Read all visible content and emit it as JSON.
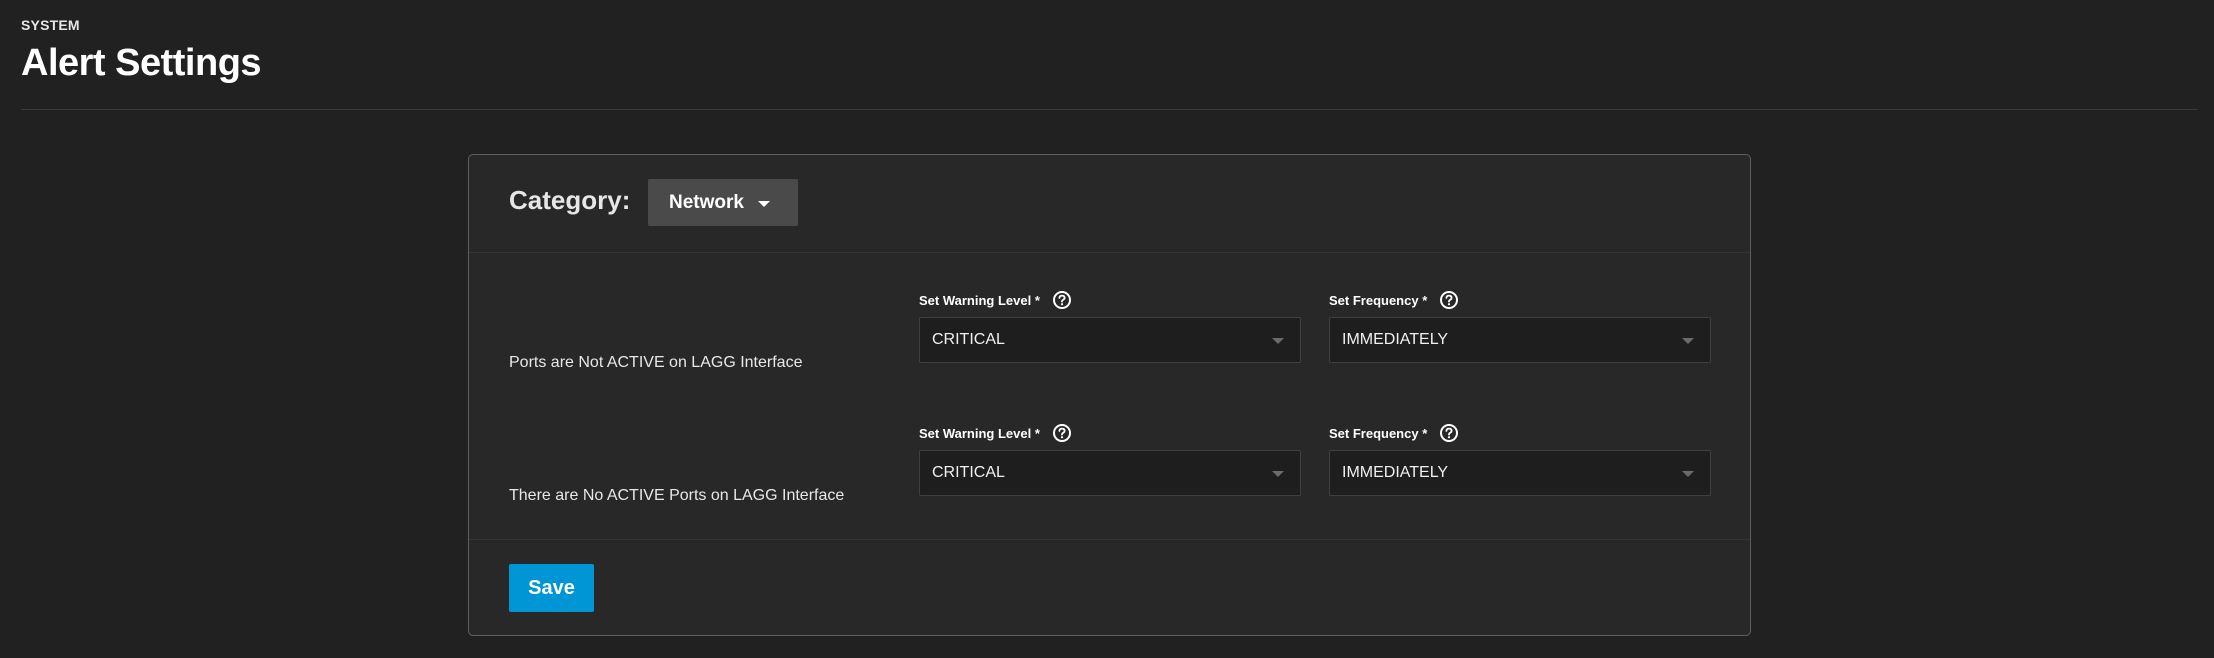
{
  "header": {
    "breadcrumb": "SYSTEM",
    "title": "Alert Settings"
  },
  "category": {
    "label": "Category:",
    "selected": "Network"
  },
  "alerts": [
    {
      "name": "Ports are Not ACTIVE on LAGG Interface",
      "warning_label": "Set Warning Level *",
      "warning_value": "CRITICAL",
      "frequency_label": "Set Frequency *",
      "frequency_value": "IMMEDIATELY"
    },
    {
      "name": "There are No ACTIVE Ports on LAGG Interface",
      "warning_label": "Set Warning Level *",
      "warning_value": "CRITICAL",
      "frequency_label": "Set Frequency *",
      "frequency_value": "IMMEDIATELY"
    }
  ],
  "actions": {
    "save_label": "Save"
  },
  "icons": {
    "help": "help-circle-icon",
    "dropdown": "chevron-down-icon"
  },
  "colors": {
    "background": "#212121",
    "card": "#282828",
    "primary": "#0095d5",
    "select_bg": "#1e1e1e"
  }
}
